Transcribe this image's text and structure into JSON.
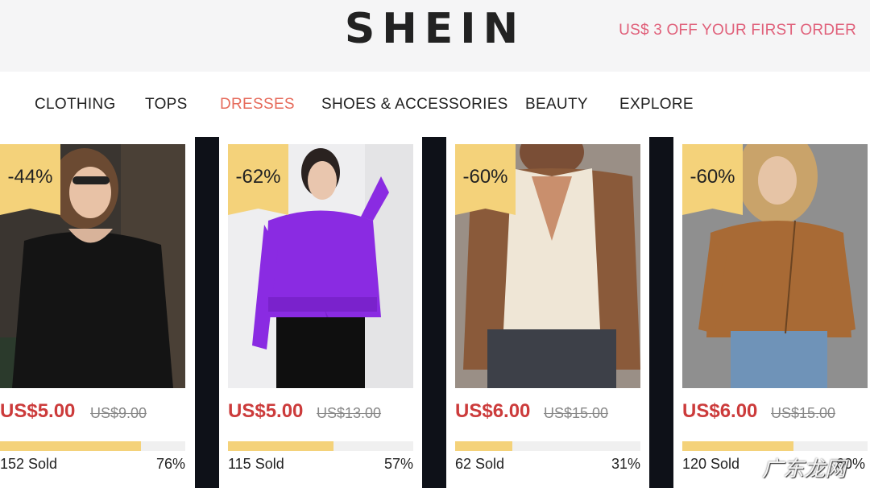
{
  "header": {
    "logo": "SHEIN",
    "promo": "US$ 3 OFF YOUR FIRST ORDER"
  },
  "nav": {
    "items": [
      {
        "label": "CLOTHING",
        "active": false
      },
      {
        "label": "TOPS",
        "active": false
      },
      {
        "label": "DRESSES",
        "active": true
      },
      {
        "label": "SHOES & ACCESSORIES",
        "active": false
      },
      {
        "label": "BEAUTY",
        "active": false
      },
      {
        "label": "EXPLORE",
        "active": false
      }
    ]
  },
  "products": [
    {
      "discount": "-44%",
      "price": "US$5.00",
      "old_price": "US$9.00",
      "sold": "152 Sold",
      "percent": "76%",
      "progress": 0.76,
      "image": "black scalloped blouse"
    },
    {
      "discount": "-62%",
      "price": "US$5.00",
      "old_price": "US$13.00",
      "sold": "115 Sold",
      "percent": "57%",
      "progress": 0.57,
      "image": "purple wrap top"
    },
    {
      "discount": "-60%",
      "price": "US$6.00",
      "old_price": "US$15.00",
      "sold": "62 Sold",
      "percent": "31%",
      "progress": 0.31,
      "image": "cream and brown shirt"
    },
    {
      "discount": "-60%",
      "price": "US$6.00",
      "old_price": "US$15.00",
      "sold": "120 Sold",
      "percent": "60%",
      "progress": 0.6,
      "image": "brown suede jacket"
    }
  ],
  "colors": {
    "accent": "#e66b5b",
    "price": "#cc3b3b",
    "badge": "#f4d27a",
    "promo": "#e0607a"
  },
  "watermark": "广东龙网"
}
